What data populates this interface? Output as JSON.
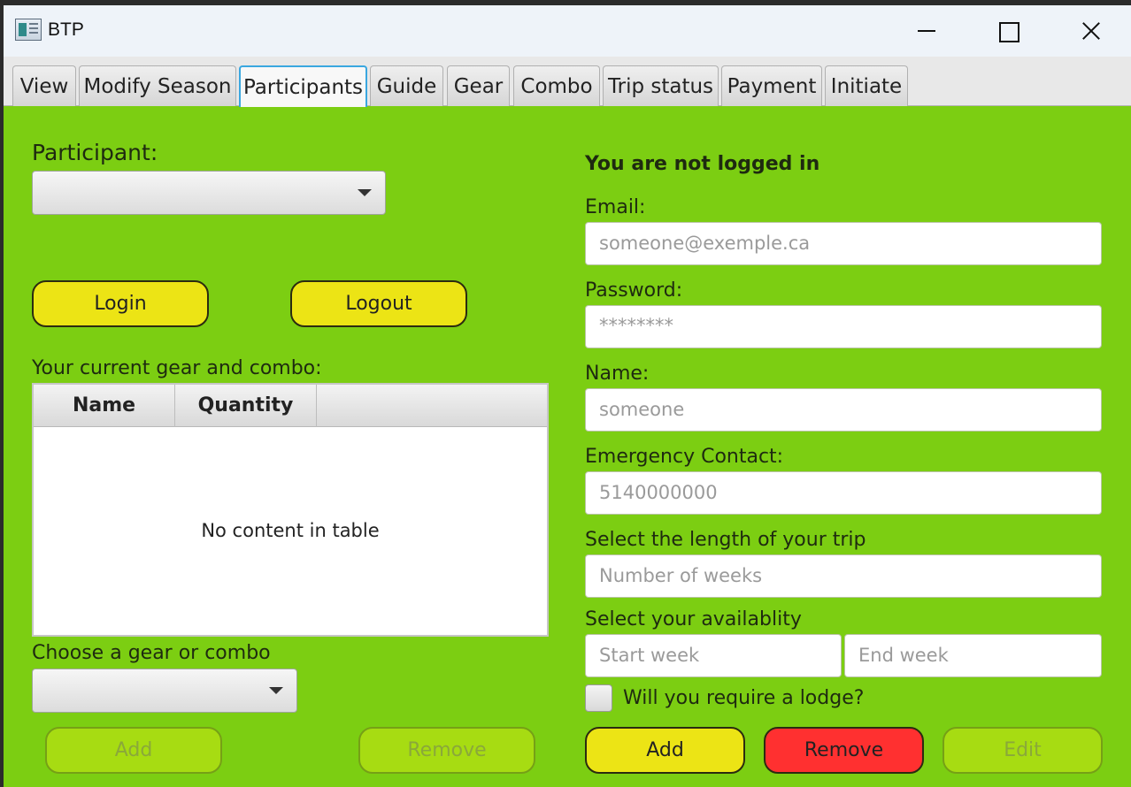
{
  "window": {
    "title": "BTP",
    "app_icon": "app-window-icon"
  },
  "tabs": [
    {
      "label": "View"
    },
    {
      "label": "Modify Season"
    },
    {
      "label": "Participants"
    },
    {
      "label": "Guide"
    },
    {
      "label": "Gear"
    },
    {
      "label": "Combo"
    },
    {
      "label": "Trip status"
    },
    {
      "label": "Payment"
    },
    {
      "label": "Initiate"
    }
  ],
  "active_tab": "Participants",
  "left": {
    "participant_label": "Participant:",
    "participant_value": "",
    "login_label": "Login",
    "logout_label": "Logout",
    "gear_label": "Your current gear and combo:",
    "table": {
      "columns": [
        "Name",
        "Quantity"
      ],
      "rows": [],
      "empty_text": "No content in table"
    },
    "choose_label": "Choose a gear or combo",
    "choose_value": "",
    "add_label": "Add",
    "remove_label": "Remove"
  },
  "right": {
    "status": "You are not logged in",
    "email_label": "Email:",
    "email_placeholder": "someone@exemple.ca",
    "password_label": "Password:",
    "password_placeholder": "********",
    "name_label": "Name:",
    "name_placeholder": "someone",
    "emergency_label": "Emergency Contact:",
    "emergency_placeholder": "5140000000",
    "length_label": "Select the length of your trip",
    "length_placeholder": "Number of weeks",
    "availability_label": "Select your availablity",
    "start_placeholder": "Start week",
    "end_placeholder": "End week",
    "lodge_label": "Will you require a lodge?",
    "lodge_checked": false,
    "add_label": "Add",
    "remove_label": "Remove",
    "edit_label": "Edit"
  },
  "colors": {
    "background": "#7cce12",
    "yellow_button": "#ece415",
    "red_button": "#ff3030",
    "disabled_button": "#a7dc12",
    "active_tab_border": "#3aa7e0"
  }
}
